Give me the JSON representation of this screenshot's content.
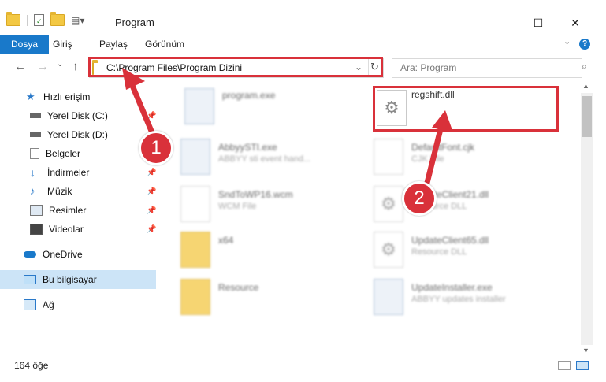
{
  "window": {
    "title": "Program",
    "minimize": "—",
    "maximize": "☐",
    "close": "✕"
  },
  "ribbon": {
    "tabs": [
      "Dosya",
      "Giriş",
      "Paylaş",
      "Görünüm"
    ]
  },
  "address": {
    "path": "C:\\Program Files\\Program Dizini",
    "search_placeholder": "Ara: Program"
  },
  "sidebar": {
    "items": [
      {
        "label": "Hızlı erişim"
      },
      {
        "label": "Yerel Disk (C:)"
      },
      {
        "label": "Yerel Disk (D:)"
      },
      {
        "label": "Belgeler"
      },
      {
        "label": "İndirmeler"
      },
      {
        "label": "Müzik"
      },
      {
        "label": "Resimler"
      },
      {
        "label": "Videolar"
      },
      {
        "label": "OneDrive"
      },
      {
        "label": "Bu bilgisayar"
      },
      {
        "label": "Ağ"
      }
    ]
  },
  "files": [
    {
      "name": "program.exe",
      "sub": ""
    },
    {
      "name": "regshift.dll",
      "sub": ""
    },
    {
      "name": "AbbyySTI.exe",
      "sub": "ABBYY sti event hand..."
    },
    {
      "name": "DefaultFont.cjk",
      "sub": "CJK File"
    },
    {
      "name": "SndToWP16.wcm",
      "sub": "WCM File"
    },
    {
      "name": "UpdateClient21.dll",
      "sub": "Resource DLL"
    },
    {
      "name": "x64",
      "sub": ""
    },
    {
      "name": "UpdateClient65.dll",
      "sub": "Resource DLL"
    },
    {
      "name": "Resource",
      "sub": ""
    },
    {
      "name": "UpdateInstaller.exe",
      "sub": "ABBYY updates installer"
    }
  ],
  "status": {
    "count": "164 öğe"
  },
  "annotations": {
    "step1": "1",
    "step2": "2"
  }
}
